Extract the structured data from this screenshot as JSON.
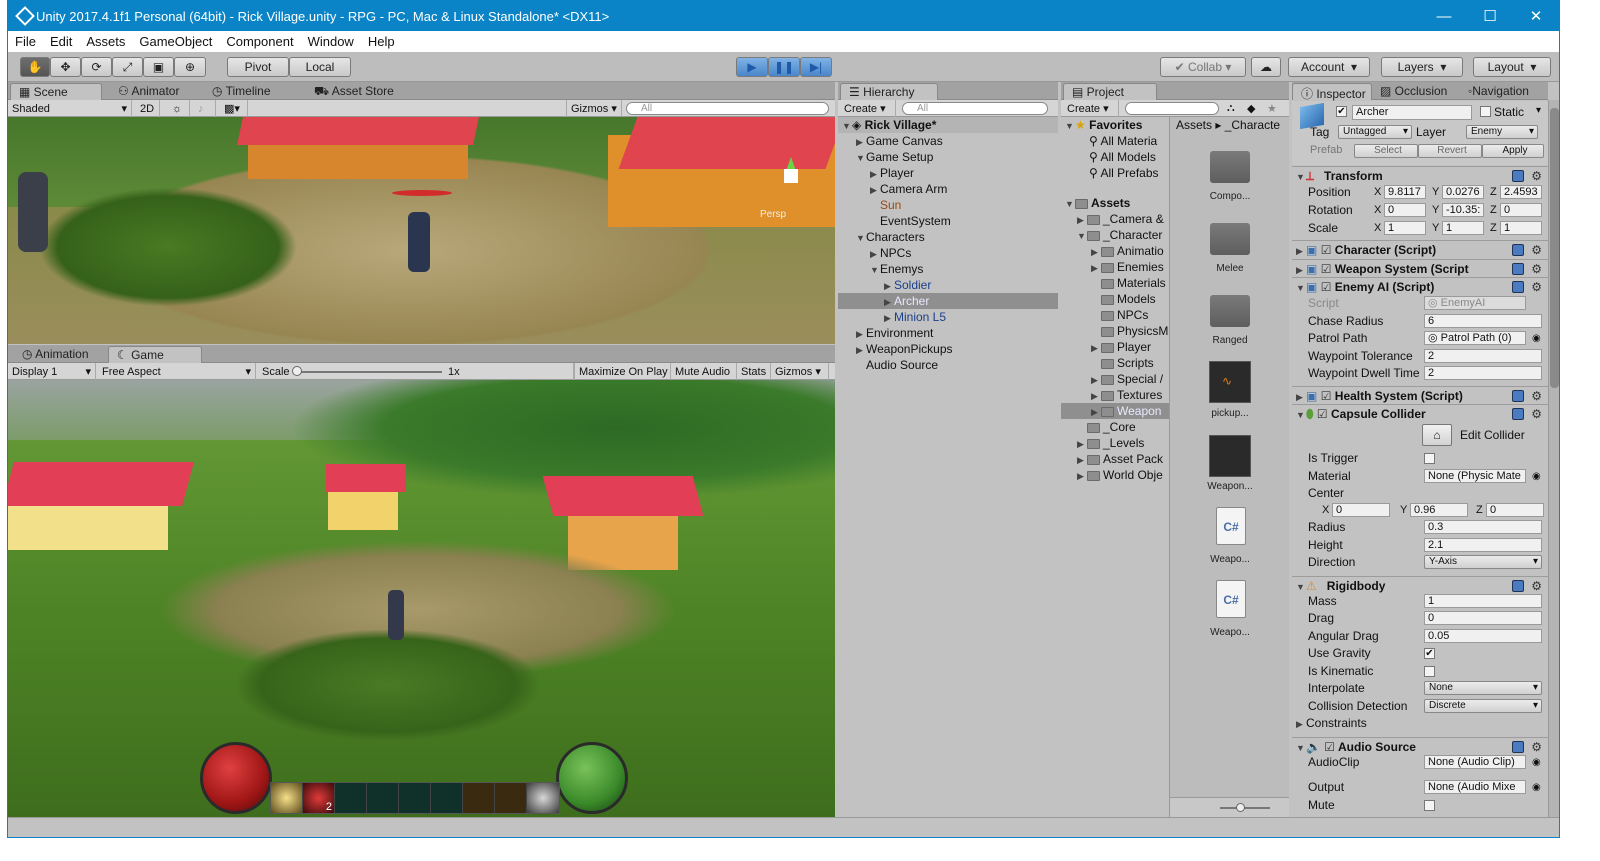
{
  "window": {
    "title": "Unity 2017.4.1f1 Personal (64bit) - Rick Village.unity - RPG - PC, Mac & Linux Standalone* <DX11>"
  },
  "menu": [
    "File",
    "Edit",
    "Assets",
    "GameObject",
    "Component",
    "Window",
    "Help"
  ],
  "toolbar": {
    "pivot": "Pivot",
    "local": "Local",
    "collab": "Collab",
    "account": "Account",
    "layers": "Layers",
    "layout": "Layout"
  },
  "scene": {
    "tabs": [
      "Scene",
      "Animator",
      "Timeline",
      "Asset Store"
    ],
    "shaded": "Shaded",
    "mode2d": "2D",
    "gizmos": "Gizmos",
    "search": "All",
    "persp": "Persp"
  },
  "game": {
    "tabs": [
      "Animation",
      "Game"
    ],
    "display": "Display 1",
    "aspect": "Free Aspect",
    "scale_label": "Scale",
    "scale_value": "1x",
    "maximize": "Maximize On Play",
    "mute": "Mute Audio",
    "stats": "Stats",
    "gizmos": "Gizmos",
    "potion_count": "2"
  },
  "hierarchy": {
    "tab": "Hierarchy",
    "create": "Create",
    "search": "All",
    "scene": "Rick Village*",
    "items": [
      {
        "label": "Game Canvas"
      },
      {
        "label": "Game Setup"
      },
      {
        "label": "Player"
      },
      {
        "label": "Camera Arm"
      },
      {
        "label": "Sun"
      },
      {
        "label": "EventSystem"
      },
      {
        "label": "Characters"
      },
      {
        "label": "NPCs"
      },
      {
        "label": "Enemys"
      },
      {
        "label": "Soldier"
      },
      {
        "label": "Archer"
      },
      {
        "label": "Minion L5"
      },
      {
        "label": "Environment"
      },
      {
        "label": "WeaponPickups"
      },
      {
        "label": "Audio Source"
      }
    ]
  },
  "project": {
    "tab": "Project",
    "create": "Create",
    "favorites": "Favorites",
    "fav_items": [
      "All Materia",
      "All Models",
      "All Prefabs"
    ],
    "assets": "Assets",
    "tree": [
      "_Camera &",
      "_Character",
      "Animatio",
      "Enemies",
      "Materials",
      "Models",
      "NPCs",
      "PhysicsM",
      "Player",
      "Scripts",
      "Special /",
      "Textures",
      "Weapon",
      "_Core",
      "_Levels",
      "Asset Pack",
      "World Obje"
    ],
    "breadcrumb": [
      "Assets",
      "_Characte"
    ],
    "grid": [
      "Compo...",
      "Melee",
      "Ranged",
      "pickup...",
      "Weapon...",
      "Weapo...",
      "Weapo..."
    ]
  },
  "inspector": {
    "tabs": [
      "Inspector",
      "Occlusion",
      "Navigation"
    ],
    "name": "Archer",
    "static": "Static",
    "tag_label": "Tag",
    "tag": "Untagged",
    "layer_label": "Layer",
    "layer": "Enemy",
    "prefab": "Prefab",
    "select": "Select",
    "revert": "Revert",
    "apply": "Apply",
    "transform": {
      "title": "Transform",
      "position_label": "Position",
      "position": [
        "9.8117",
        "0.0276",
        "2.4593"
      ],
      "rotation_label": "Rotation",
      "rotation": [
        "0",
        "-10.35:",
        "0"
      ],
      "scale_label": "Scale",
      "scale": [
        "1",
        "1",
        "1"
      ]
    },
    "character_script": "Character (Script)",
    "weapon_script": "Weapon System (Script",
    "enemy_ai": {
      "title": "Enemy AI (Script)",
      "script_label": "Script",
      "script": "EnemyAI",
      "chase_label": "Chase Radius",
      "chase": "6",
      "patrol_label": "Patrol Path",
      "patrol": "Patrol Path (0)",
      "tol_label": "Waypoint Tolerance",
      "tol": "2",
      "dwell_label": "Waypoint Dwell Time",
      "dwell": "2"
    },
    "health_script": "Health System (Script)",
    "capsule": {
      "title": "Capsule Collider",
      "edit": "Edit Collider",
      "trigger_label": "Is Trigger",
      "material_label": "Material",
      "material": "None (Physic Matе",
      "center_label": "Center",
      "center": [
        "0",
        "0.96",
        "0"
      ],
      "radius_label": "Radius",
      "radius": "0.3",
      "height_label": "Height",
      "height": "2.1",
      "direction_label": "Direction",
      "direction": "Y-Axis"
    },
    "rigidbody": {
      "title": "Rigidbody",
      "mass_label": "Mass",
      "mass": "1",
      "drag_label": "Drag",
      "drag": "0",
      "adrag_label": "Angular Drag",
      "adrag": "0.05",
      "gravity_label": "Use Gravity",
      "kinematic_label": "Is Kinematic",
      "interp_label": "Interpolate",
      "interp": "None",
      "coll_label": "Collision Detection",
      "coll": "Discrete",
      "constraints": "Constraints"
    },
    "audio": {
      "title": "Audio Source",
      "clip_label": "AudioClip",
      "clip": "None (Audio Clip)",
      "output_label": "Output",
      "output": "None (Audio Mixe",
      "mute_label": "Mute"
    }
  }
}
